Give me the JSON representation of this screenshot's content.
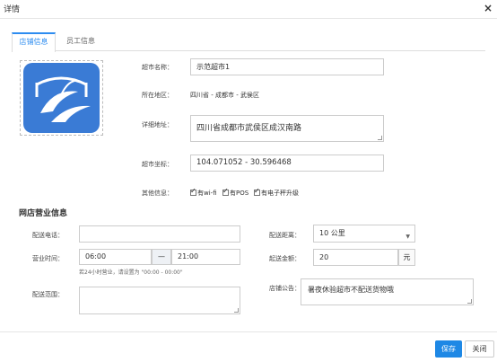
{
  "dialog": {
    "title": "详情"
  },
  "tabs": [
    {
      "label": "店铺信息"
    },
    {
      "label": "员工信息"
    }
  ],
  "store": {
    "name_label": "超市名称：",
    "name_value": "示范超市1",
    "region_label": "所在地区：",
    "region_value": "四川省 - 成都市 - 武侯区",
    "address_label": "详细地址：",
    "address_value": "四川省成都市武侯区成汉南路",
    "coords_label": "超市坐标：",
    "coords_value": "104.071052 - 30.596468",
    "other_label": "其他信息：",
    "other_options": [
      "有wi-fi",
      "有POS",
      "有电子秤升级"
    ]
  },
  "business": {
    "section_title": "网店营业信息",
    "phone_label": "配送电话：",
    "phone_value": "",
    "range_label": "配送距离：",
    "range_value": "10 公里",
    "hours_label": "营业时间：",
    "hours_start": "06:00",
    "hours_sep": "—",
    "hours_end": "21:00",
    "hours_hint": "若24小时营业，请设置为 \"00:00 - 00:00\"",
    "min_label": "起送金额：",
    "min_value": "20",
    "min_unit": "元",
    "area_label": "配送范围：",
    "area_value": "",
    "notice_label": "店铺公告：",
    "notice_value": "暑夜休验超市不配送货物哦"
  },
  "footer": {
    "save_label": "保存",
    "close_label": "关闭"
  },
  "colors": {
    "accent": "#1e88e5",
    "logo_bg": "#3a7bd5"
  }
}
